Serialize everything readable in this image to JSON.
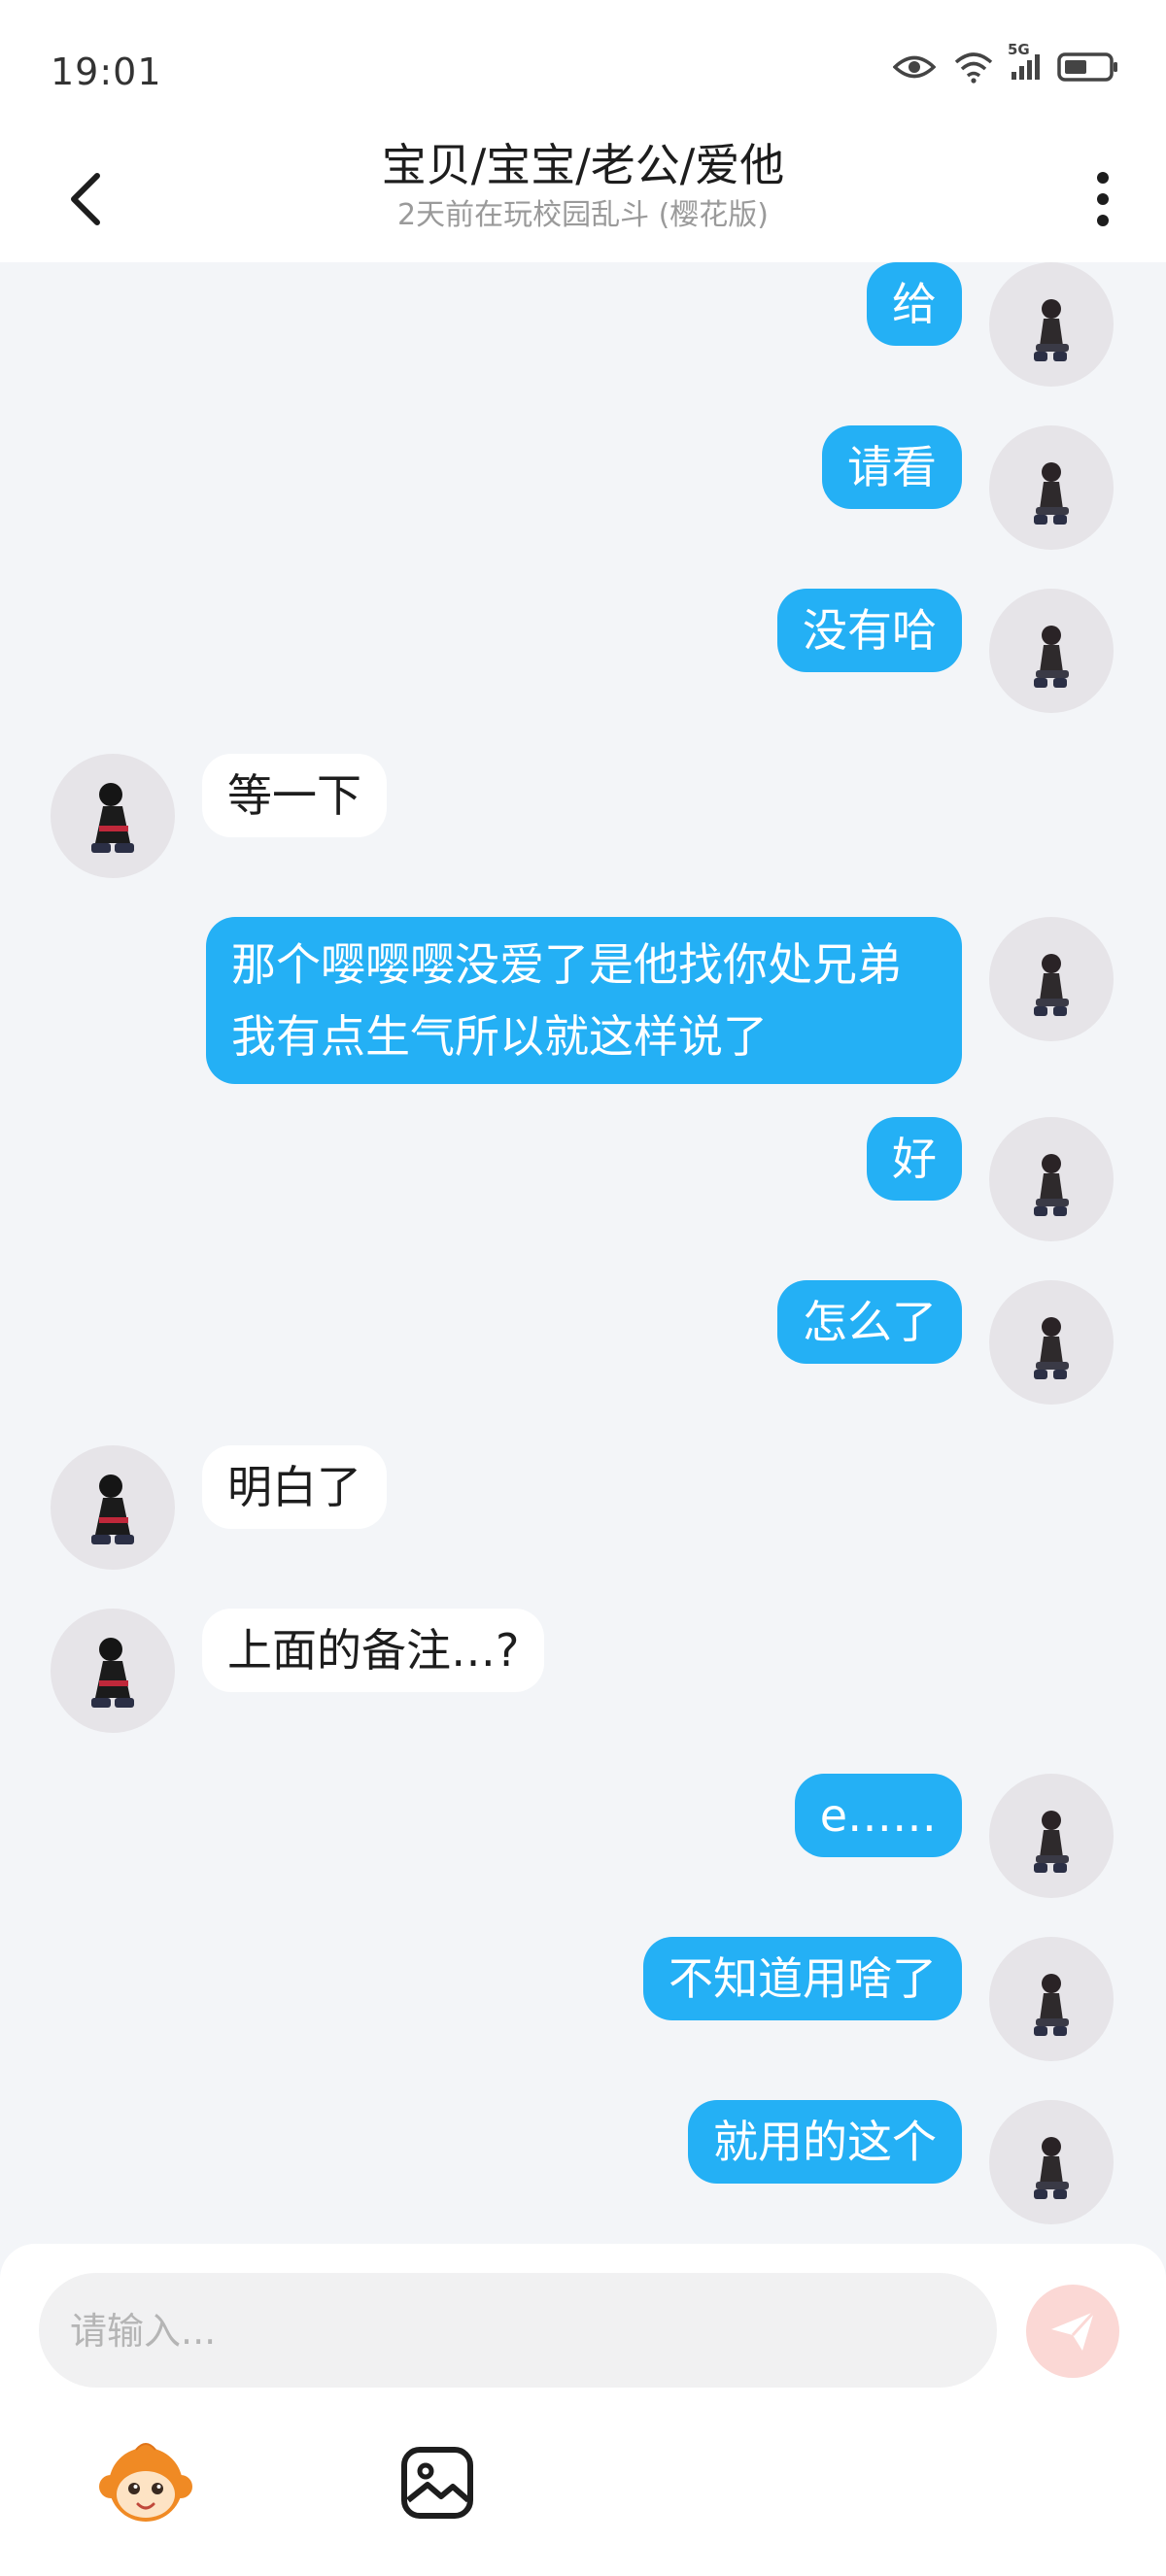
{
  "status_bar": {
    "time": "19:01",
    "network": "5G"
  },
  "header": {
    "title": "宝贝/宝宝/老公/爱他",
    "subtitle": "2天前在玩校园乱斗 (樱花版)"
  },
  "messages": [
    {
      "side": "out",
      "text": "给"
    },
    {
      "side": "out",
      "text": "请看"
    },
    {
      "side": "out",
      "text": "没有哈"
    },
    {
      "side": "in",
      "text": "等一下"
    },
    {
      "side": "out",
      "text": "那个嘤嘤嘤没爱了是他找你处兄弟我有点生气所以就这样说了"
    },
    {
      "side": "out",
      "text": "好"
    },
    {
      "side": "out",
      "text": "怎么了"
    },
    {
      "side": "in",
      "text": "明白了"
    },
    {
      "side": "in",
      "text": "上面的备注…?"
    },
    {
      "side": "out",
      "text": "e……"
    },
    {
      "side": "out",
      "text": "不知道用啥了"
    },
    {
      "side": "out",
      "text": "就用的这个"
    }
  ],
  "input": {
    "placeholder": "请输入..."
  },
  "colors": {
    "out_bubble": "#24b0f5",
    "in_bubble": "#ffffff",
    "send_button": "#fbd8d5",
    "background": "#f3f5f8"
  }
}
